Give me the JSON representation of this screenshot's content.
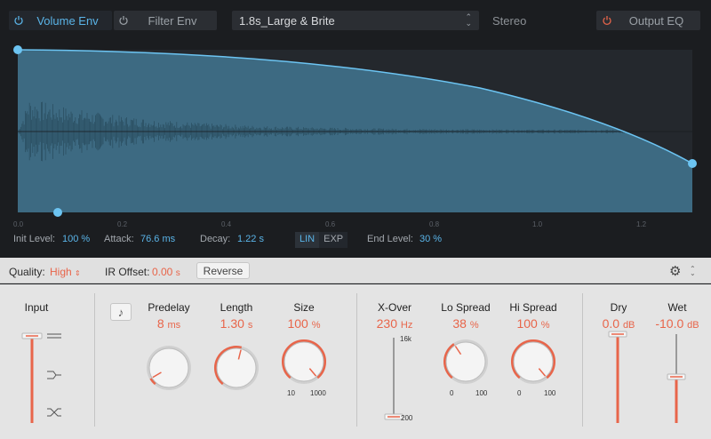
{
  "tabs": {
    "volume_env": "Volume Env",
    "filter_env": "Filter Env",
    "output_eq": "Output EQ"
  },
  "preset": "1.8s_Large & Brite",
  "stereo": "Stereo",
  "time_ticks": [
    "0.0",
    "0.2",
    "0.4",
    "0.6",
    "0.8",
    "1.0",
    "1.2"
  ],
  "envelope": {
    "init_level_label": "Init Level:",
    "init_level": "100 %",
    "attack_label": "Attack:",
    "attack": "76.6 ms",
    "decay_label": "Decay:",
    "decay": "1.22 s",
    "lin": "LIN",
    "exp": "EXP",
    "end_level_label": "End Level:",
    "end_level": "30 %"
  },
  "quality": {
    "label": "Quality:",
    "value": "High",
    "ir_offset_label": "IR Offset:",
    "ir_offset_value": "0.00",
    "ir_offset_unit": "s",
    "reverse": "Reverse"
  },
  "controls": {
    "input": {
      "label": "Input"
    },
    "predelay": {
      "label": "Predelay",
      "value": "8",
      "unit": "ms",
      "level": 0.07
    },
    "length": {
      "label": "Length",
      "value": "1.30",
      "unit": "s",
      "level": 0.55
    },
    "size": {
      "label": "Size",
      "value": "100",
      "unit": "%",
      "level": 1.0,
      "min": "10",
      "max": "1000"
    },
    "xover": {
      "label": "X-Over",
      "value": "230",
      "unit": "Hz",
      "top": "16k",
      "bottom": "200"
    },
    "lo_spread": {
      "label": "Lo Spread",
      "value": "38",
      "unit": "%",
      "level": 0.38,
      "min": "0",
      "max": "100"
    },
    "hi_spread": {
      "label": "Hi Spread",
      "value": "100",
      "unit": "%",
      "level": 1.0,
      "min": "0",
      "max": "100"
    },
    "dry": {
      "label": "Dry",
      "value": "0.0",
      "unit": "dB"
    },
    "wet": {
      "label": "Wet",
      "value": "-10.0",
      "unit": "dB"
    }
  },
  "colors": {
    "accent_blue": "#5ab4e8",
    "accent_orange": "#e8654a"
  }
}
